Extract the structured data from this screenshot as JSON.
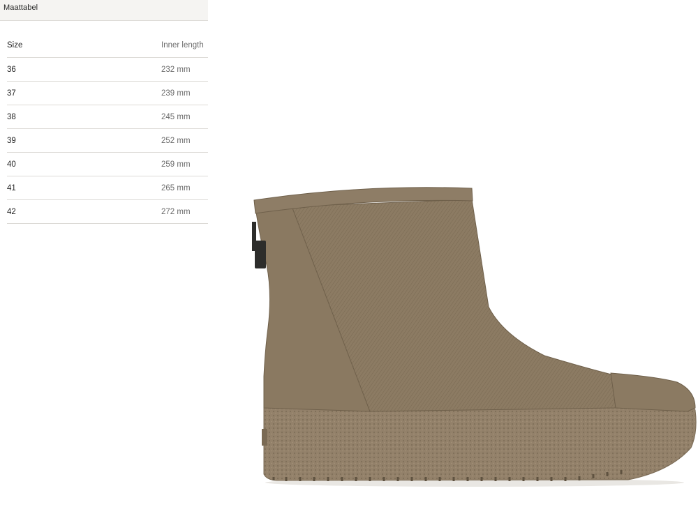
{
  "panel": {
    "title": "Maattabel"
  },
  "table": {
    "headers": {
      "size": "Size",
      "inner_length": "Inner length"
    },
    "rows": [
      {
        "size": "36",
        "inner_length": "232 mm"
      },
      {
        "size": "37",
        "inner_length": "239 mm"
      },
      {
        "size": "38",
        "inner_length": "245 mm"
      },
      {
        "size": "39",
        "inner_length": "252 mm"
      },
      {
        "size": "40",
        "inner_length": "259 mm"
      },
      {
        "size": "41",
        "inner_length": "265 mm"
      },
      {
        "size": "42",
        "inner_length": "272 mm"
      }
    ]
  },
  "product": {
    "image_icon": "ankle-boot-icon",
    "color_main": "#8c7b63",
    "color_dark": "#6f604b",
    "color_light": "#a08e74",
    "zipper_color": "#2d2d2b"
  }
}
